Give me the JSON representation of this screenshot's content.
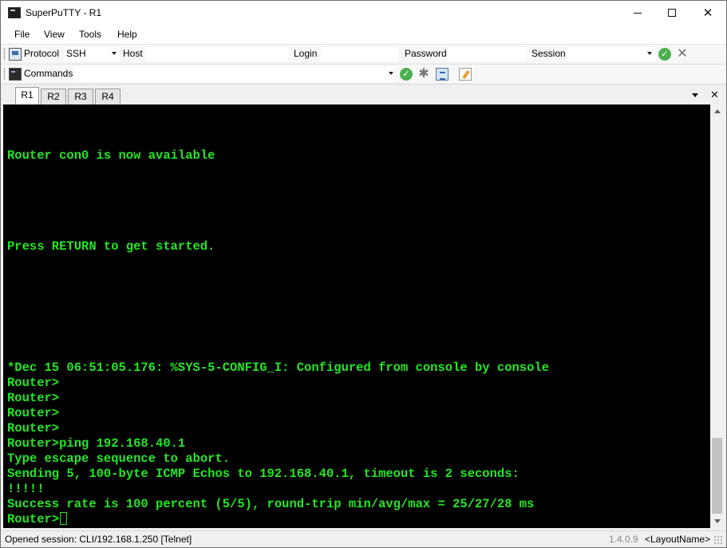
{
  "window": {
    "title": "SuperPuTTY - R1"
  },
  "menu": {
    "items": [
      "File",
      "View",
      "Tools",
      "Help"
    ]
  },
  "connection_toolbar": {
    "protocol_label": "Protocol",
    "protocol_value": "SSH",
    "host_label": "Host",
    "host_value": "",
    "login_label": "Login",
    "login_value": "",
    "password_label": "Password",
    "password_value": "",
    "session_label": "Session",
    "session_value": ""
  },
  "commands_toolbar": {
    "label": "Commands",
    "value": ""
  },
  "tabs": [
    {
      "label": "R1",
      "active": true
    },
    {
      "label": "R2",
      "active": false
    },
    {
      "label": "R3",
      "active": false
    },
    {
      "label": "R4",
      "active": false
    }
  ],
  "terminal": {
    "lines": [
      "",
      "",
      "Router con0 is now available",
      "",
      "",
      "",
      "",
      "",
      "Press RETURN to get started.",
      "",
      "",
      "",
      "",
      "",
      "",
      "",
      "*Dec 15 06:51:05.176: %SYS-5-CONFIG_I: Configured from console by console",
      "Router>",
      "Router>",
      "Router>",
      "Router>",
      "Router>ping 192.168.40.1",
      "Type escape sequence to abort.",
      "Sending 5, 100-byte ICMP Echos to 192.168.40.1, timeout is 2 seconds:",
      "!!!!!",
      "Success rate is 100 percent (5/5), round-trip min/avg/max = 25/27/28 ms",
      "Router>"
    ],
    "text_color": "#25e625",
    "background": "#000000"
  },
  "statusbar": {
    "session_text": "Opened session: CLI/192.168.1.250 [Telnet]",
    "version": "1.4.0.9",
    "layout": "<LayoutName>"
  }
}
